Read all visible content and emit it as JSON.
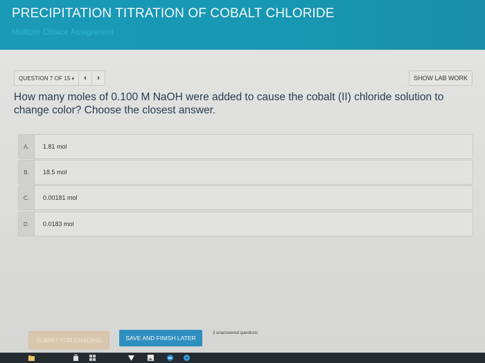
{
  "header": {
    "title": "PRECIPITATION TITRATION OF COBALT CHLORIDE",
    "subtitle": "Multiple Choice Assignment"
  },
  "nav": {
    "question_label": "QUESTION 7 OF 15",
    "prev_icon": "chevron-left-icon",
    "next_icon": "chevron-right-icon",
    "show_lab_work": "SHOW LAB WORK"
  },
  "question": {
    "text": "How many moles of 0.100 M NaOH were added to cause the cobalt (II) chloride solution to change color? Choose the closest answer."
  },
  "choices": [
    {
      "letter": "A.",
      "text": "1.81 mol"
    },
    {
      "letter": "B.",
      "text": "18.5 mol"
    },
    {
      "letter": "C.",
      "text": "0.00181 mol"
    },
    {
      "letter": "D.",
      "text": "0.0183 mol"
    }
  ],
  "footer": {
    "submit_label": "SUBMIT FOR GRADING",
    "save_label": "SAVE AND FINISH LATER",
    "unanswered_text": "3 unanswered questions"
  },
  "colors": {
    "header": "#1a9ab7",
    "save_button": "#2f8fbf",
    "submit_button": "#d8c7ae",
    "question_text": "#2b3d4f"
  },
  "taskbar": {
    "icons": [
      "file-explorer-icon",
      "store-icon",
      "grid-app-icon",
      "vpn-icon",
      "photos-icon",
      "edge-icon",
      "chrome-icon"
    ]
  }
}
